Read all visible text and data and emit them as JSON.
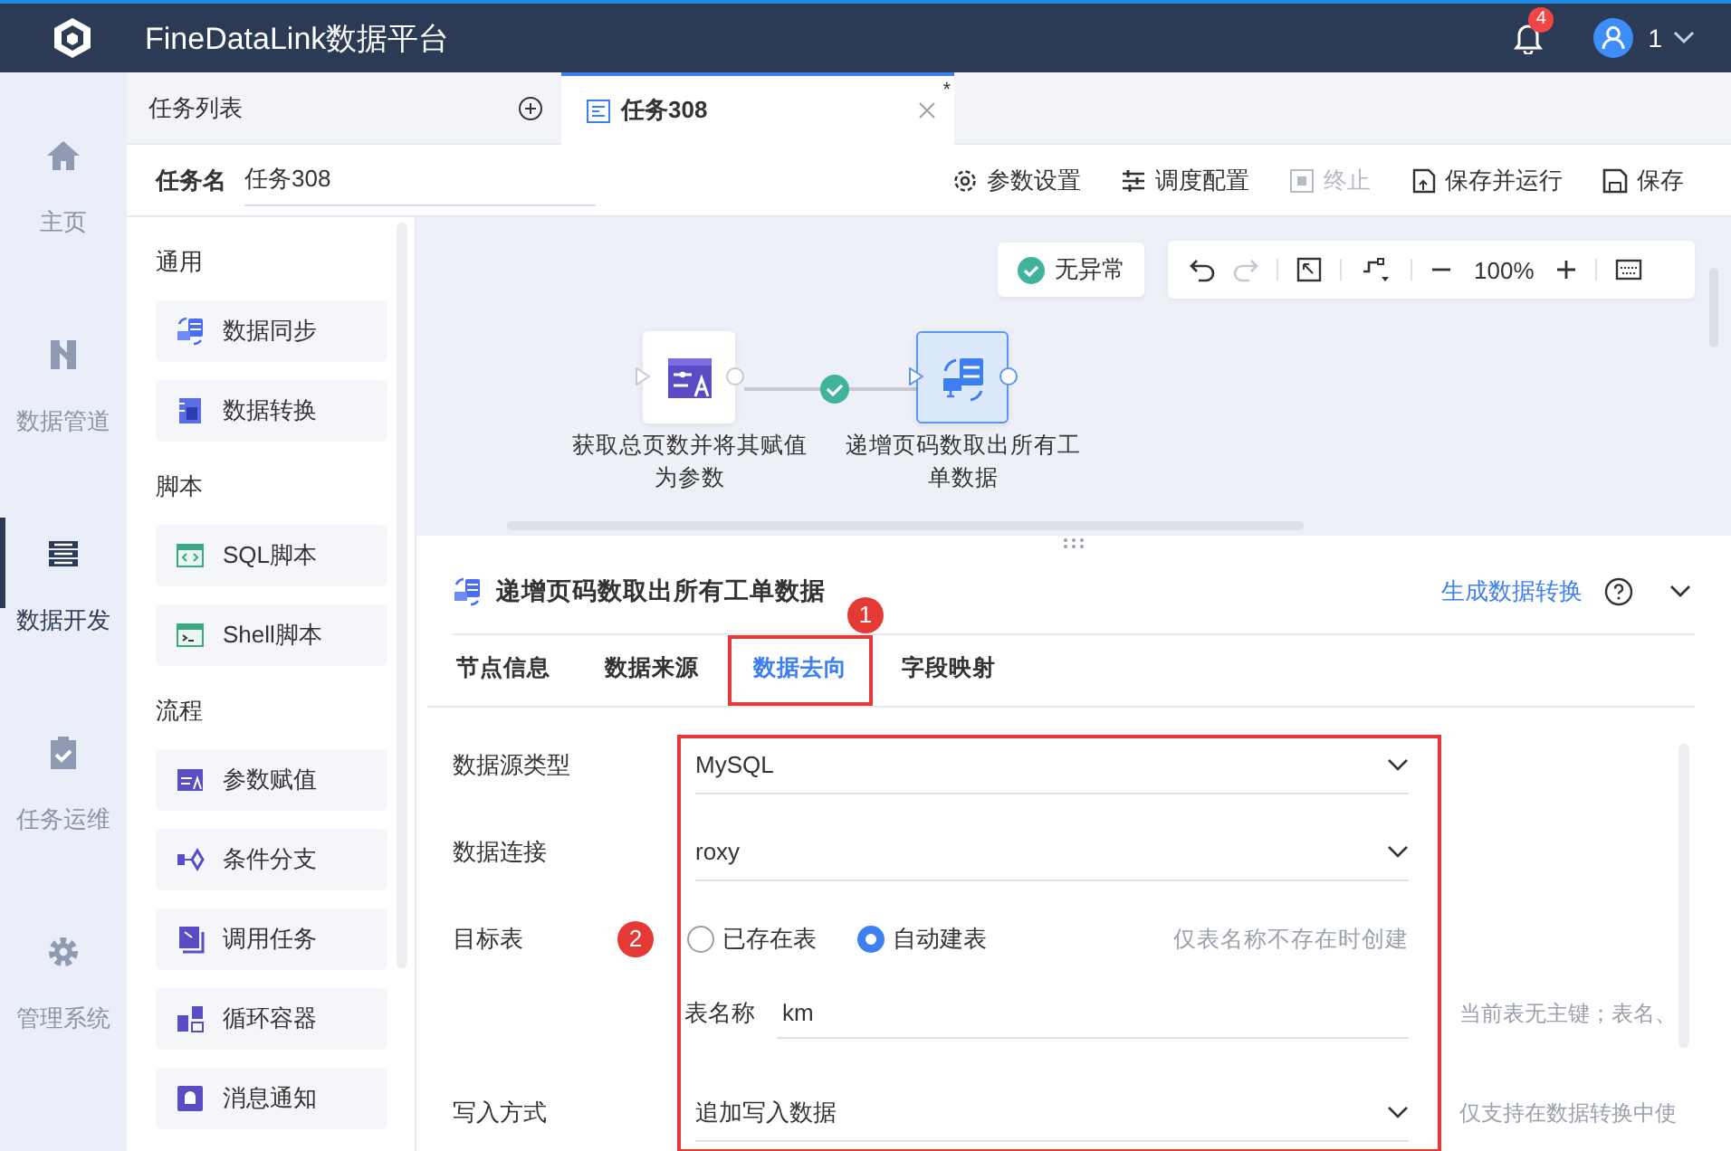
{
  "header": {
    "title": "FineDataLink数据平台",
    "notifications": "4",
    "user": "1"
  },
  "nav": [
    {
      "label": "主页",
      "selected": false
    },
    {
      "label": "数据管道",
      "selected": false
    },
    {
      "label": "数据开发",
      "selected": true
    },
    {
      "label": "任务运维",
      "selected": false
    },
    {
      "label": "管理系统",
      "selected": false
    }
  ],
  "task_list": {
    "label": "任务列表"
  },
  "tabs": [
    {
      "label": "任务308",
      "selected": true,
      "unsaved_mark": "*"
    }
  ],
  "task_name": {
    "label": "任务名",
    "value": "任务308"
  },
  "actions": [
    {
      "label": "参数设置",
      "disabled": false
    },
    {
      "label": "调度配置",
      "disabled": false
    },
    {
      "label": "终止",
      "disabled": true
    },
    {
      "label": "保存并运行",
      "disabled": false
    },
    {
      "label": "保存",
      "disabled": false
    }
  ],
  "palette": [
    {
      "heading": "通用",
      "items": [
        {
          "label": "数据同步"
        },
        {
          "label": "数据转换"
        }
      ]
    },
    {
      "heading": "脚本",
      "items": [
        {
          "label": "SQL脚本"
        },
        {
          "label": "Shell脚本"
        }
      ]
    },
    {
      "heading": "流程",
      "items": [
        {
          "label": "参数赋值"
        },
        {
          "label": "条件分支"
        },
        {
          "label": "调用任务"
        },
        {
          "label": "循环容器"
        },
        {
          "label": "消息通知"
        }
      ]
    }
  ],
  "canvas": {
    "status": "无异常",
    "zoom": "100%",
    "nodes": [
      {
        "label": "获取总页数并将其赋值为参数",
        "selected": false
      },
      {
        "label": "递增页码数取出所有工单数据",
        "selected": true
      }
    ]
  },
  "node_panel": {
    "title": "递增页码数取出所有工单数据",
    "link": "生成数据转换",
    "tabs": [
      {
        "label": "节点信息",
        "selected": false
      },
      {
        "label": "数据来源",
        "selected": false
      },
      {
        "label": "数据去向",
        "selected": true
      },
      {
        "label": "字段映射",
        "selected": false
      }
    ],
    "tab_callout": "1",
    "form_callout": "2",
    "fields": [
      {
        "kind": "select",
        "label": "数据源类型",
        "value": "MySQL"
      },
      {
        "kind": "select",
        "label": "数据连接",
        "value": "roxy"
      },
      {
        "kind": "radio",
        "label": "目标表",
        "options": [
          {
            "label": "已存在表",
            "selected": false
          },
          {
            "label": "自动建表",
            "selected": true
          }
        ],
        "hint": "仅表名称不存在时创建"
      },
      {
        "kind": "input",
        "label": "表名称",
        "value": "km",
        "note": "当前表无主键；表名、"
      },
      {
        "kind": "select",
        "label": "写入方式",
        "value": "追加写入数据",
        "note": "仅支持在数据转换中使"
      }
    ]
  }
}
